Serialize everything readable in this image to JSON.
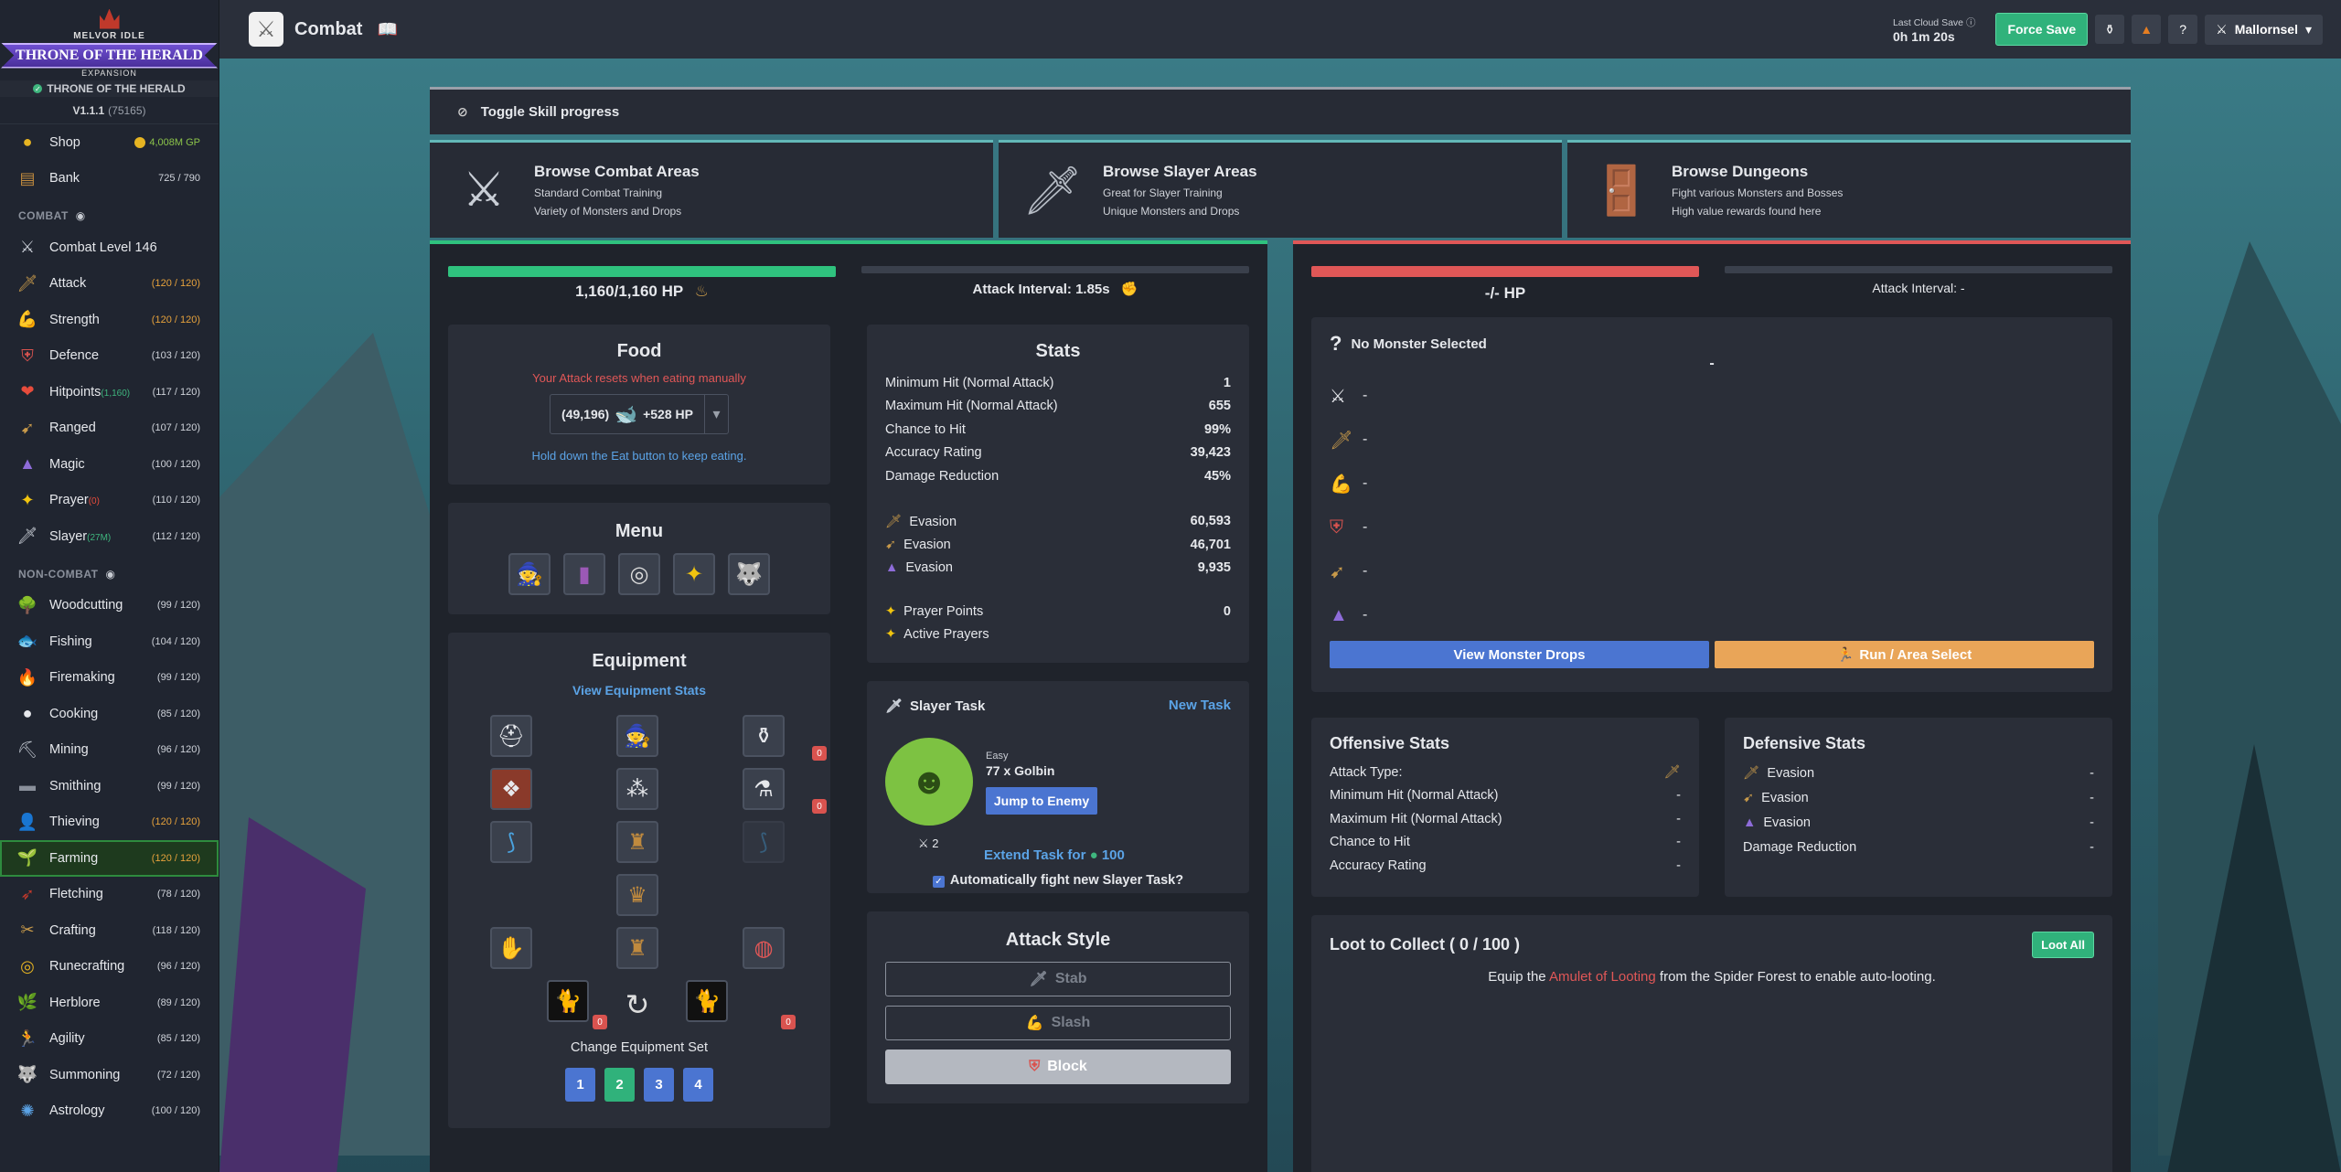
{
  "logo": {
    "top_text": "MELVOR IDLE",
    "banner": "THRONE OF THE HERALD",
    "sub": "EXPANSION"
  },
  "expansion_label": "THRONE OF THE HERALD",
  "version": {
    "main": "V1.1.1",
    "build": "(75165)"
  },
  "sidebar": {
    "top_items": [
      {
        "label": "Shop",
        "value": "4,008M GP",
        "icon": "gold-coin-icon"
      },
      {
        "label": "Bank",
        "value": "725 / 790",
        "icon": "bank-chest-icon"
      }
    ],
    "combat_header": "COMBAT",
    "combat_items": [
      {
        "label": "Combat Level 146",
        "level": "",
        "extra": "",
        "max": false
      },
      {
        "label": "Attack",
        "level": "(120 / 120)",
        "extra": "",
        "max": true
      },
      {
        "label": "Strength",
        "level": "(120 / 120)",
        "extra": "",
        "max": true
      },
      {
        "label": "Defence",
        "level": "(103 / 120)",
        "extra": "",
        "max": false
      },
      {
        "label": "Hitpoints",
        "level": "(117 / 120)",
        "extra": "(1,160)",
        "max": false
      },
      {
        "label": "Ranged",
        "level": "(107 / 120)",
        "extra": "",
        "max": false
      },
      {
        "label": "Magic",
        "level": "(100 / 120)",
        "extra": "",
        "max": false
      },
      {
        "label": "Prayer",
        "level": "(110 / 120)",
        "extra": "(0)",
        "max": false
      },
      {
        "label": "Slayer",
        "level": "(112 / 120)",
        "extra": "(27M)",
        "max": false
      }
    ],
    "noncombat_header": "NON-COMBAT",
    "noncombat_items": [
      {
        "label": "Woodcutting",
        "level": "(99 / 120)",
        "max": false
      },
      {
        "label": "Fishing",
        "level": "(104 / 120)",
        "max": false
      },
      {
        "label": "Firemaking",
        "level": "(99 / 120)",
        "max": false
      },
      {
        "label": "Cooking",
        "level": "(85 / 120)",
        "max": false
      },
      {
        "label": "Mining",
        "level": "(96 / 120)",
        "max": false
      },
      {
        "label": "Smithing",
        "level": "(99 / 120)",
        "max": false
      },
      {
        "label": "Thieving",
        "level": "(120 / 120)",
        "max": true
      },
      {
        "label": "Farming",
        "level": "(120 / 120)",
        "max": true
      },
      {
        "label": "Fletching",
        "level": "(78 / 120)",
        "max": false
      },
      {
        "label": "Crafting",
        "level": "(118 / 120)",
        "max": false
      },
      {
        "label": "Runecrafting",
        "level": "(96 / 120)",
        "max": false
      },
      {
        "label": "Herblore",
        "level": "(89 / 120)",
        "max": false
      },
      {
        "label": "Agility",
        "level": "(85 / 120)",
        "max": false
      },
      {
        "label": "Summoning",
        "level": "(72 / 120)",
        "max": false
      },
      {
        "label": "Astrology",
        "level": "(100 / 120)",
        "max": false
      }
    ]
  },
  "topbar": {
    "title": "Combat",
    "cloud_label": "Last Cloud Save",
    "cloud_time": "0h 1m 20s",
    "force_save": "Force Save",
    "help": "?",
    "username": "Mallornsel"
  },
  "toggle_label": "Toggle Skill progress",
  "browse": [
    {
      "title": "Browse Combat Areas",
      "line1": "Standard Combat Training",
      "line2": "Variety of Monsters and Drops"
    },
    {
      "title": "Browse Slayer Areas",
      "line1": "Great for Slayer Training",
      "line2": "Unique Monsters and Drops"
    },
    {
      "title": "Browse Dungeons",
      "line1": "Fight various Monsters and Bosses",
      "line2": "High value rewards found here"
    }
  ],
  "player": {
    "hp_text": "1,160/1,160 HP",
    "hp_fraction": 1.0,
    "attack_interval": "Attack Interval: 1.85s",
    "food": {
      "title": "Food",
      "warning": "Your Attack resets when eating manually",
      "qty": "(49,196)",
      "heal": "+528 HP",
      "hint": "Hold down the Eat button to keep eating."
    },
    "menu_title": "Menu",
    "equipment": {
      "title": "Equipment",
      "stats_link": "View Equipment Stats",
      "badge1": "0",
      "badge2": "0",
      "badge3": "0",
      "badge4": "0",
      "change_set": "Change Equipment Set",
      "sets": [
        "1",
        "2",
        "3",
        "4"
      ]
    },
    "stats": {
      "title": "Stats",
      "rows": [
        {
          "label": "Minimum Hit (Normal Attack)",
          "value": "1"
        },
        {
          "label": "Maximum Hit (Normal Attack)",
          "value": "655"
        },
        {
          "label": "Chance to Hit",
          "value": "99%"
        },
        {
          "label": "Accuracy Rating",
          "value": "39,423"
        },
        {
          "label": "Damage Reduction",
          "value": "45%"
        }
      ],
      "evasion": [
        {
          "label": "Evasion",
          "value": "60,593"
        },
        {
          "label": "Evasion",
          "value": "46,701"
        },
        {
          "label": "Evasion",
          "value": "9,935"
        }
      ],
      "prayer_points_label": "Prayer Points",
      "prayer_points": "0",
      "active_prayers": "Active Prayers"
    },
    "slayer": {
      "title": "Slayer Task",
      "new_task": "New Task",
      "difficulty": "Easy",
      "task": "77 x Golbin",
      "jump": "Jump to Enemy",
      "kills": "2",
      "extend": "Extend Task for",
      "extend_cost": "100",
      "auto": "Automatically fight new Slayer Task?"
    },
    "attack_style": {
      "title": "Attack Style",
      "styles": [
        "Stab",
        "Slash",
        "Block"
      ]
    }
  },
  "enemy": {
    "hp_text": "-/- HP",
    "attack_interval": "Attack Interval: -",
    "no_monster": "No Monster Selected",
    "dash": "-",
    "rows": [
      "-",
      "-",
      "-",
      "-",
      "-",
      "-"
    ],
    "view_drops": "View Monster Drops",
    "run": "Run / Area Select",
    "offensive": {
      "title": "Offensive Stats",
      "rows": [
        {
          "label": "Attack Type:",
          "value": ""
        },
        {
          "label": "Minimum Hit (Normal Attack)",
          "value": "-"
        },
        {
          "label": "Maximum Hit (Normal Attack)",
          "value": "-"
        },
        {
          "label": "Chance to Hit",
          "value": "-"
        },
        {
          "label": "Accuracy Rating",
          "value": "-"
        }
      ]
    },
    "defensive": {
      "title": "Defensive Stats",
      "rows": [
        {
          "label": "Evasion",
          "value": "-"
        },
        {
          "label": "Evasion",
          "value": "-"
        },
        {
          "label": "Evasion",
          "value": "-"
        },
        {
          "label": "Damage Reduction",
          "value": "-"
        }
      ]
    },
    "loot": {
      "title": "Loot to Collect ( 0 / 100 )",
      "loot_all": "Loot All",
      "pre": "Equip the",
      "item": "Amulet of Looting",
      "post": "from the Spider Forest to enable auto-looting."
    }
  },
  "colors": {
    "accent_green": "#30b27b",
    "hp_green": "#2fc27e",
    "enemy_red": "#e05757",
    "link_blue": "#5ba3e6",
    "max_orange": "#e6a23c"
  }
}
